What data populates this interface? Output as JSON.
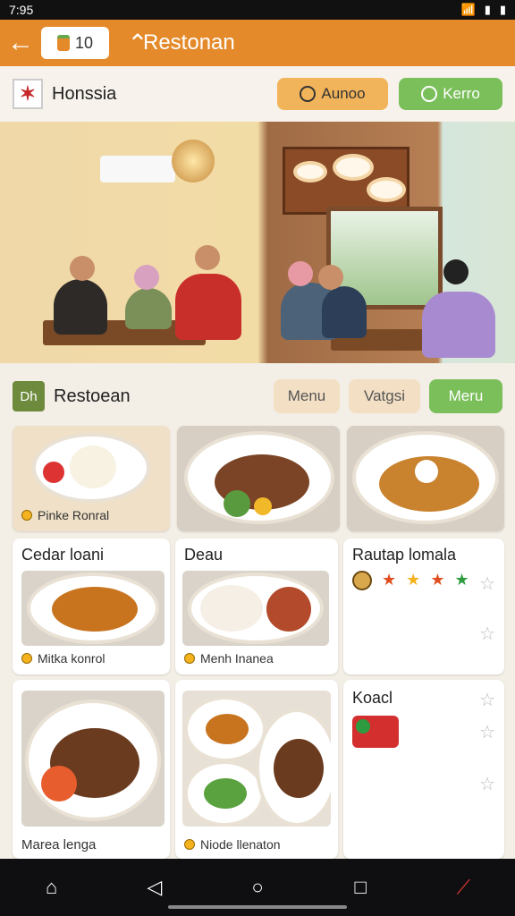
{
  "status": {
    "time": "7:95"
  },
  "appbar": {
    "title": "Restonan",
    "cart_count": "10"
  },
  "subheader": {
    "name": "Honssia",
    "chip1": "Aunoo",
    "chip2": "Kerro"
  },
  "section": {
    "title": "Restoean",
    "logo": "Dh",
    "tabs": [
      "Menu",
      "Vatgsi",
      "Meru"
    ]
  },
  "cards": {
    "c1_caption": "Pinke Ronral",
    "c4_title": "Cedar loani",
    "c4_caption": "Mitka konrol",
    "c5_title": "Deau",
    "c5_caption": "Menh Inanea",
    "c6_title": "Rautap lomala",
    "c7_caption": "Marea lenga",
    "c8_caption": "Niode llenaton",
    "c9_title": "Koacl"
  },
  "colors": {
    "primary": "#e58a2a",
    "accent_green": "#7bbf5b",
    "chip_orange": "#f2b45a",
    "tab_beige": "#f3dfc4"
  }
}
